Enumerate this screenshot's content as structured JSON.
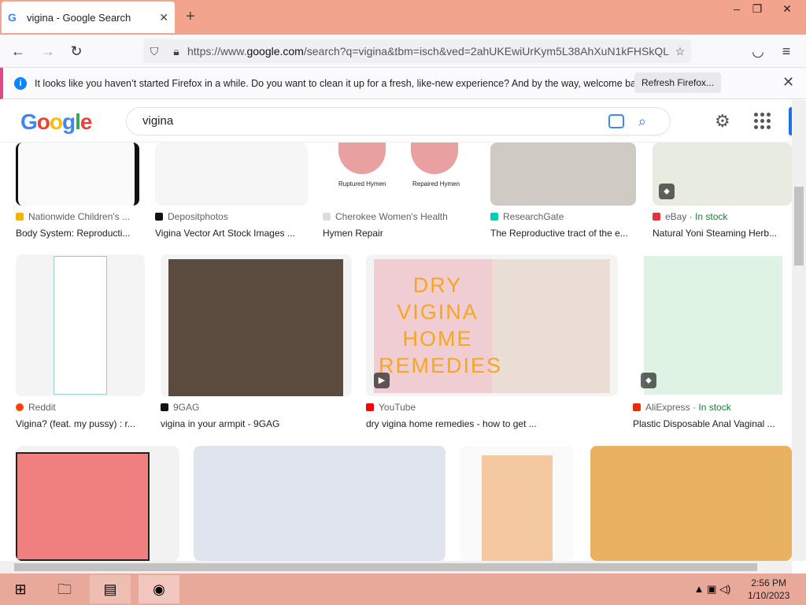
{
  "browser": {
    "tab_title": "vigina - Google Search",
    "url_prefix": "https://www.",
    "url_domain": "google.com",
    "url_rest": "/search?q=vigina&tbm=isch&ved=2ahUKEwiUrKym5L38AhXuN1kFHSkQL"
  },
  "notification": {
    "message": "It looks like you haven’t started Firefox in a while. Do you want to clean it up for a fresh, like-new experience? And by the way, welcome back!",
    "button": "Refresh Firefox..."
  },
  "google": {
    "logo": "Google",
    "query": "vigina"
  },
  "results": {
    "row1": [
      {
        "source": "Nationwide Children's ...",
        "title": "Body System: Reproducti...",
        "color": "#f4b400"
      },
      {
        "source": "Depositphotos",
        "title": "Vigina Vector Art Stock Images ...",
        "color": "#111111"
      },
      {
        "source": "Cherokee Women's Health",
        "title": "Hymen Repair",
        "color": "#dddddd",
        "label_a": "Ruptured Hymen",
        "label_b": "Repaired Hymen"
      },
      {
        "source": "ResearchGate",
        "title": "The Reproductive tract of the e...",
        "color": "#00ccbb"
      },
      {
        "source": "eBay",
        "stock": "In stock",
        "title": "Natural Yoni Steaming Herb...",
        "color": "#e53238"
      }
    ],
    "row2": [
      {
        "source": "Reddit",
        "title": "Vigina? (feat. my pussy) : r...",
        "color": "#ff4500"
      },
      {
        "source": "9GAG",
        "title": "vigina in your armpit - 9GAG",
        "color": "#111111"
      },
      {
        "source": "YouTube",
        "title": "dry vigina home remedies - how to get ...",
        "color": "#ff0000",
        "overlay": "DRY VIGINA HOME REMEDIES"
      },
      {
        "source": "AliExpress",
        "stock": "In stock",
        "title": "Plastic Disposable Anal Vaginal ...",
        "color": "#e62e04"
      }
    ]
  },
  "taskbar": {
    "time": "2:56 PM",
    "date": "1/10/2023"
  }
}
